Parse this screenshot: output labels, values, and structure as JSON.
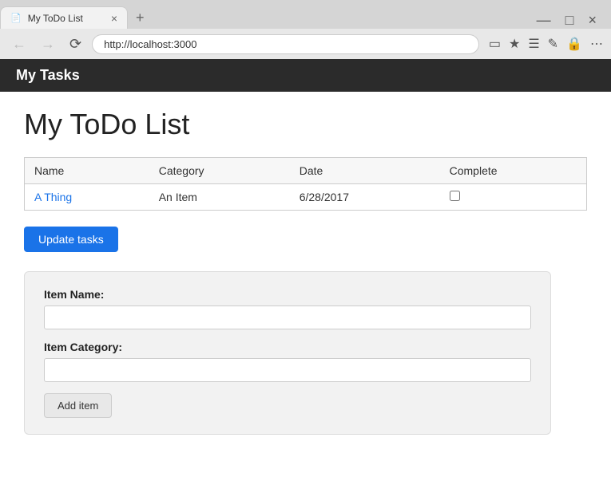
{
  "browser": {
    "tab_favicon": "📄",
    "tab_title": "My ToDo List",
    "tab_close": "×",
    "new_tab": "+",
    "url": "http://localhost:3000",
    "window_minimize": "—",
    "window_maximize": "□",
    "window_close": "×"
  },
  "header": {
    "title": "My Tasks"
  },
  "page": {
    "title": "My ToDo List"
  },
  "table": {
    "columns": [
      "Name",
      "Category",
      "Date",
      "Complete"
    ],
    "rows": [
      {
        "name": "A Thing",
        "category": "An Item",
        "date": "6/28/2017",
        "complete": false
      }
    ]
  },
  "buttons": {
    "update_tasks": "Update tasks",
    "add_item": "Add item"
  },
  "form": {
    "item_name_label": "Item Name:",
    "item_name_placeholder": "",
    "item_category_label": "Item Category:",
    "item_category_placeholder": ""
  }
}
